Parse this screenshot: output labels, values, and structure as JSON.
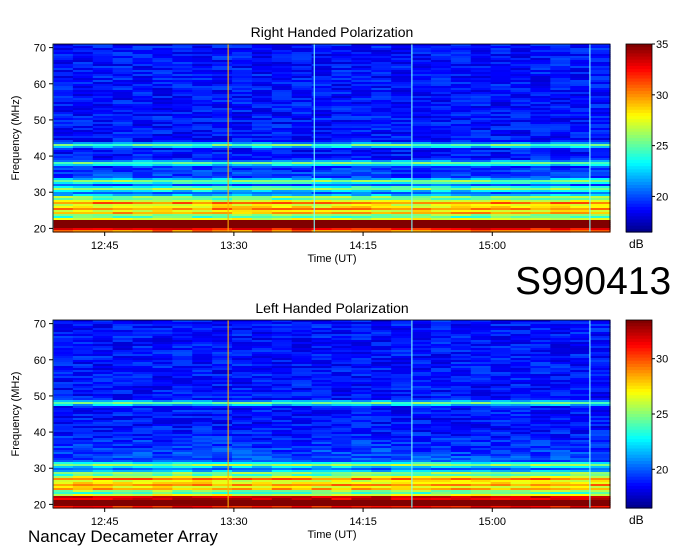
{
  "observation_id": "S990413",
  "instrument": "Nancay Decameter Array",
  "chart_data": [
    {
      "type": "heatmap",
      "title": "Right Handed Polarization",
      "xlabel": "Time (UT)",
      "ylabel": "Frequency (MHz)",
      "x_ticks": [
        "12:45",
        "13:30",
        "14:15",
        "15:00"
      ],
      "x_tick_values_min": [
        765,
        810,
        855,
        900
      ],
      "xlim_min": [
        747,
        941
      ],
      "y_ticks": [
        20,
        30,
        40,
        50,
        60,
        70
      ],
      "ylim": [
        19,
        71
      ],
      "colorbar": {
        "label": "dB",
        "ticks": [
          20,
          25,
          30,
          35
        ],
        "range": [
          16.5,
          35
        ],
        "colormap": "jet"
      },
      "features": {
        "bright_bands_mhz": [
          20.5,
          21.5,
          22.5,
          24,
          25.5,
          27,
          28.5,
          31,
          33,
          38,
          43
        ],
        "vertical_lines_min": [
          747,
          808,
          838,
          872,
          934
        ]
      }
    },
    {
      "type": "heatmap",
      "title": "Left Handed Polarization",
      "xlabel": "Time (UT)",
      "ylabel": "Frequency (MHz)",
      "x_ticks": [
        "12:45",
        "13:30",
        "14:15",
        "15:00"
      ],
      "x_tick_values_min": [
        765,
        810,
        855,
        900
      ],
      "xlim_min": [
        747,
        941
      ],
      "y_ticks": [
        20,
        30,
        40,
        50,
        60,
        70
      ],
      "ylim": [
        19,
        71
      ],
      "colorbar": {
        "label": "dB",
        "ticks": [
          20,
          25,
          30
        ],
        "range": [
          16.5,
          33.5
        ],
        "colormap": "jet"
      },
      "features": {
        "bright_bands_mhz": [
          20,
          21,
          22.5,
          24,
          25.5,
          27,
          28.5,
          31,
          48
        ],
        "vertical_lines_min": [
          747,
          808,
          872,
          934
        ]
      }
    }
  ],
  "colors": {
    "jet_low": "#00007f",
    "jet_mid": "#00ffff",
    "jet_high": "#7f0000",
    "line_marker": "#ffb000"
  }
}
